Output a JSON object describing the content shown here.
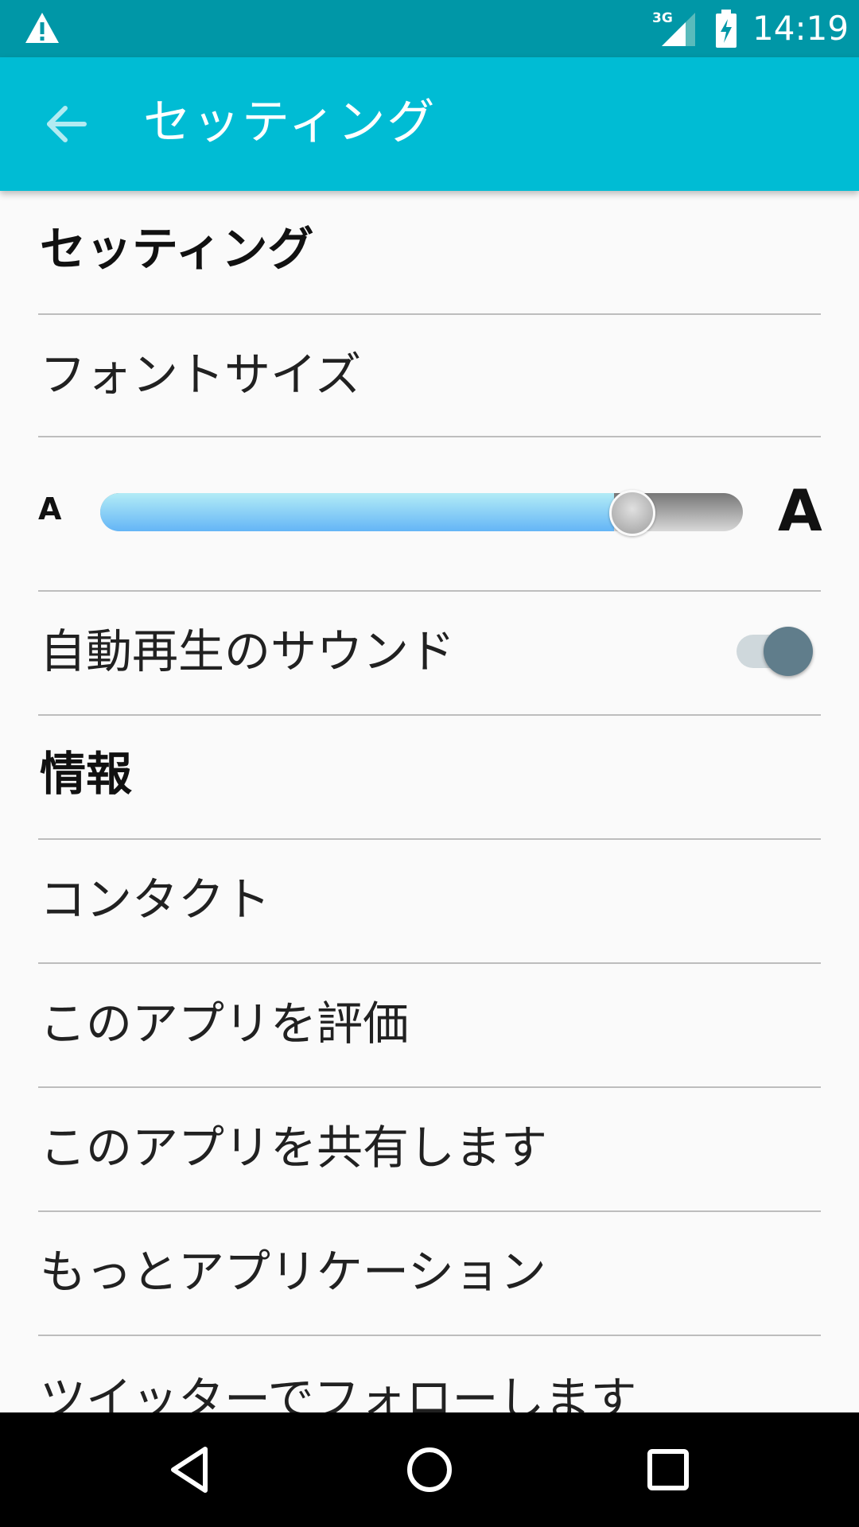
{
  "status_bar": {
    "time": "14:19",
    "network": "3G",
    "icons": [
      "warning-icon",
      "signal-icon",
      "battery-charging-icon"
    ]
  },
  "app_bar": {
    "title": "セッティング",
    "back_icon": "arrow-left-icon"
  },
  "sections": {
    "settings_header": "セッティング",
    "font_size_label": "フォントサイズ",
    "font_slider": {
      "small_label": "A",
      "large_label": "A",
      "value_fraction": 0.8
    },
    "autoplay_sound_label": "自動再生のサウンド",
    "autoplay_sound_enabled": true,
    "info_header": "情報",
    "items": [
      "コンタクト",
      "このアプリを評価",
      "このアプリを共有します",
      "もっとアプリケーション",
      "ツイッターでフォローします"
    ]
  },
  "nav_bar": {
    "icons": [
      "back-triangle-icon",
      "home-circle-icon",
      "recents-square-icon"
    ]
  },
  "colors": {
    "status_bar": "#0097a7",
    "app_bar": "#00bcd4",
    "switch_thumb": "#607d8b",
    "slider_fill": "#64b5f6"
  }
}
